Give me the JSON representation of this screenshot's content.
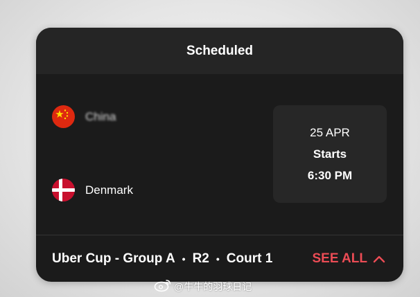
{
  "card": {
    "title": "Scheduled",
    "teams": [
      {
        "name": "China",
        "flag": "china-flag-icon"
      },
      {
        "name": "Denmark",
        "flag": "denmark-flag-icon"
      }
    ],
    "schedule": {
      "date": "25 APR",
      "status": "Starts",
      "time": "6:30 PM"
    },
    "footer": {
      "competition": "Uber Cup - Group A",
      "round": "R2",
      "court": "Court 1",
      "see_all_label": "SEE ALL",
      "see_all_icon": "chevron-up-icon"
    }
  },
  "watermark": {
    "text": "@牛牛的羽球日记",
    "icon": "weibo-icon"
  },
  "colors": {
    "accent": "#ec4c55",
    "card_bg": "#1b1b1b",
    "header_bg": "#252525",
    "time_box_bg": "#272727"
  }
}
